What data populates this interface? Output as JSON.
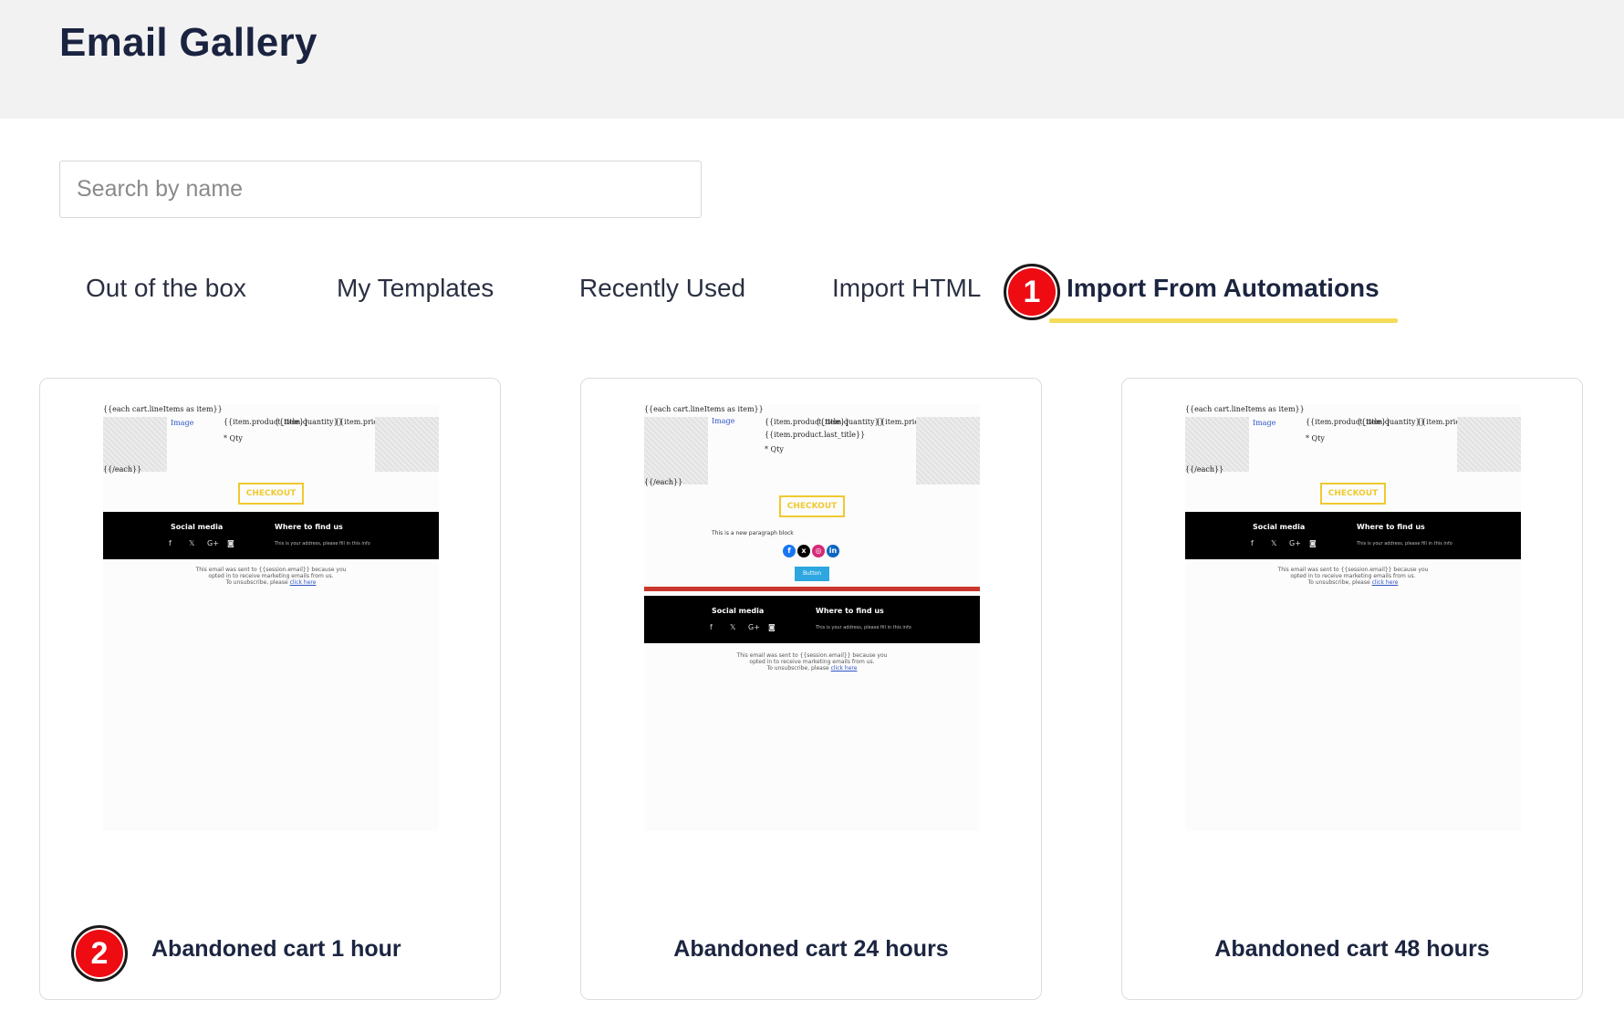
{
  "header": {
    "title": "Email Gallery"
  },
  "search": {
    "placeholder": "Search by name"
  },
  "tabs": [
    {
      "label": "Out of the box",
      "active": false
    },
    {
      "label": "My Templates",
      "active": false
    },
    {
      "label": "Recently Used",
      "active": false
    },
    {
      "label": "Import HTML",
      "active": false
    },
    {
      "label": "Import From Automations",
      "active": true
    }
  ],
  "markers": [
    "1",
    "2"
  ],
  "colors": {
    "accent_underline": "#f4dc5a",
    "marker": "#ee0b12",
    "checkout": "#f0c930"
  },
  "thumb": {
    "loop": "{{each cart.lineItems as item}}",
    "image_link": "Image",
    "product_title": "{{item.product_title}}",
    "quantity": "{{item.quantity}}",
    "price": "{{item.price}}",
    "qty_line": "* Qty",
    "loop_end": "{{/each}}",
    "variant": "{{item.product.last_title}}",
    "checkout": "CHECKOUT",
    "social_heading": "Social media",
    "find_heading": "Where to find us",
    "address": "This is your address, please fill in this info",
    "social_icons": [
      "facebook-icon",
      "x-icon",
      "google-plus-icon",
      "instagram-icon"
    ],
    "legal_line1": "This email was sent to {{session.email}} because you",
    "legal_line2": "opted in to receive marketing emails from us.",
    "legal_line3": "To unsubscribe, please",
    "legal_link": "click here",
    "text_block": "This is a new paragraph block",
    "button_label": "Button"
  },
  "cards": [
    {
      "title": "Abandoned cart 1 hour"
    },
    {
      "title": "Abandoned cart 24 hours"
    },
    {
      "title": "Abandoned cart 48 hours"
    }
  ]
}
